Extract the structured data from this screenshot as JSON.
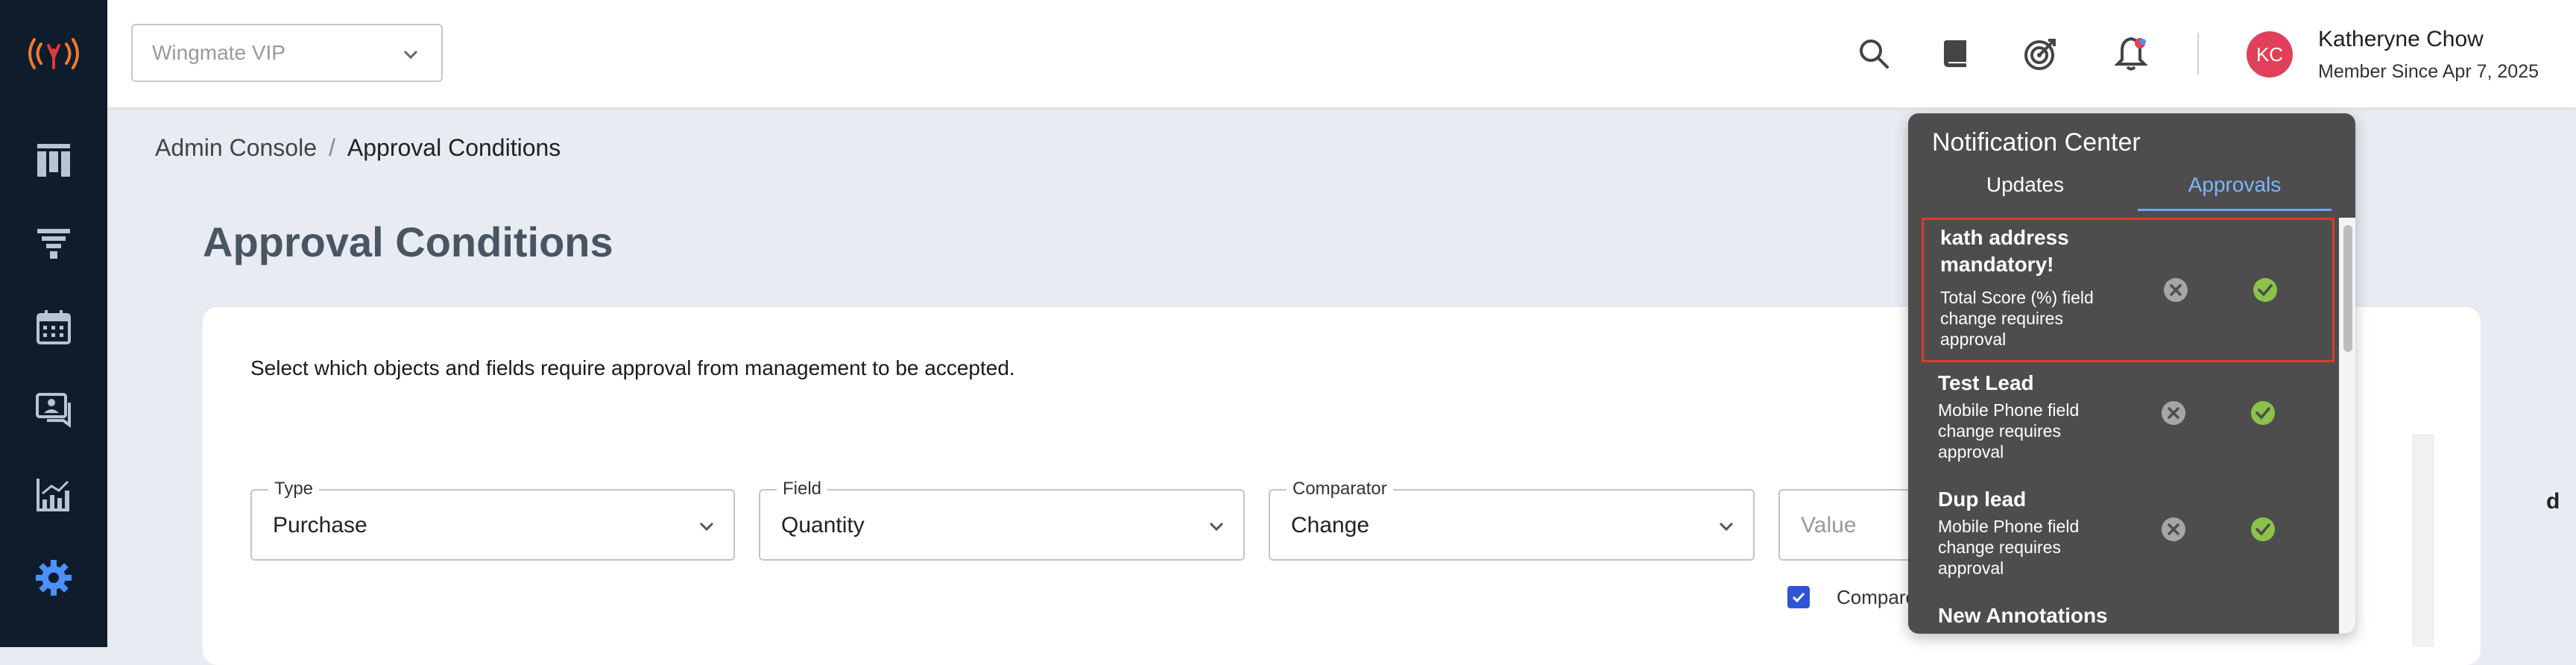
{
  "org_select": {
    "value": "Wingmate VIP"
  },
  "user": {
    "initials": "KC",
    "name": "Katheryne Chow",
    "member_since": "Member Since Apr 7, 2025",
    "avatar_color": "#e0405a"
  },
  "breadcrumb": {
    "parent": "Admin Console",
    "separator": "/",
    "current": "Approval Conditions"
  },
  "page": {
    "title": "Approval Conditions",
    "description": "Select which objects and fields require approval from management to be accepted."
  },
  "condition_row": {
    "type": {
      "label": "Type",
      "value": "Purchase"
    },
    "field": {
      "label": "Field",
      "value": "Quantity"
    },
    "comparator": {
      "label": "Comparator",
      "value": "Change"
    },
    "value": {
      "placeholder": "Value"
    },
    "compare_label": "Compare",
    "partial_label": "d"
  },
  "notification_center": {
    "title": "Notification Center",
    "tabs": [
      "Updates",
      "Approvals"
    ],
    "active_tab": "Approvals",
    "items": [
      {
        "title": "kath address mandatory!",
        "description": "Total Score (%) field change requires approval"
      },
      {
        "title": "Test Lead",
        "description": "Mobile Phone field change requires approval"
      },
      {
        "title": "Dup lead",
        "description": "Mobile Phone field change requires approval"
      },
      {
        "title": "New Annotations",
        "description": ""
      }
    ]
  },
  "colors": {
    "sidebar_bg": "#0e1c2b",
    "accent": "#2f55d4",
    "approve": "#8bc34a",
    "selected_border": "#e0392b"
  },
  "icons": {
    "sidebar": [
      "signal-logo-icon",
      "board-icon",
      "funnel-icon",
      "calendar-icon",
      "chat-icon",
      "analytics-icon",
      "gear-icon"
    ],
    "topbar": [
      "search-icon",
      "book-icon",
      "target-icon",
      "bell-icon"
    ]
  }
}
